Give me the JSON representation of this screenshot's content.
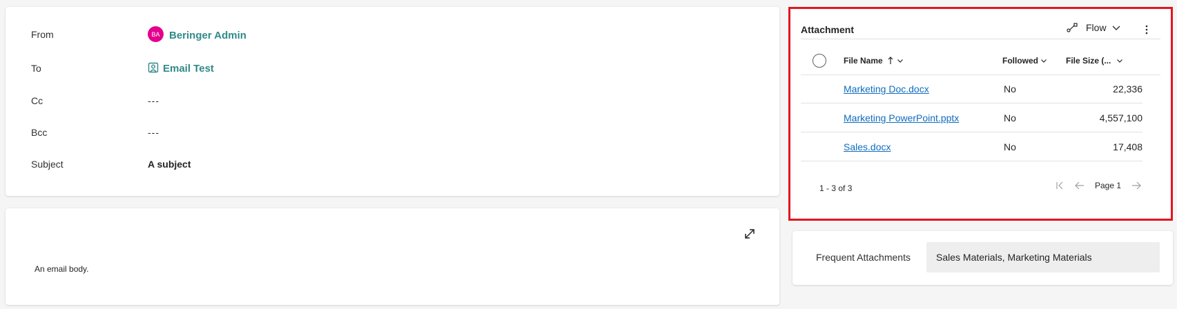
{
  "header": {
    "from_label": "From",
    "from_initials": "BA",
    "from_value": "Beringer Admin",
    "to_label": "To",
    "to_value": "Email Test",
    "cc_label": "Cc",
    "cc_value": "---",
    "bcc_label": "Bcc",
    "bcc_value": "---",
    "subject_label": "Subject",
    "subject_value": "A subject"
  },
  "body": {
    "text": "An email body."
  },
  "attachment": {
    "title": "Attachment",
    "flow_label": "Flow",
    "columns": {
      "file_name": "File Name",
      "followed": "Followed",
      "file_size": "File Size (..."
    },
    "rows": [
      {
        "file_name": "Marketing Doc.docx",
        "followed": "No",
        "file_size": "22,336"
      },
      {
        "file_name": "Marketing PowerPoint.pptx",
        "followed": "No",
        "file_size": "4,557,100"
      },
      {
        "file_name": "Sales.docx",
        "followed": "No",
        "file_size": "17,408"
      }
    ],
    "pager_count": "1 - 3 of 3",
    "page_label": "Page 1"
  },
  "frequent": {
    "label": "Frequent Attachments",
    "value": "Sales Materials, Marketing Materials"
  },
  "colors": {
    "avatar": "#e3008c",
    "lookup_link": "#2f8a88",
    "file_link": "#0f6cbd",
    "highlight_border": "#e3141e"
  },
  "icons": {
    "expand": "expand-icon",
    "flow": "flow-icon",
    "more": "more-vertical-icon",
    "sort_up": "sort-ascending-icon",
    "chevron": "chevron-down-icon",
    "first_page": "first-page-icon",
    "prev_page": "previous-page-icon",
    "next_page": "next-page-icon",
    "contact": "contact-card-icon"
  }
}
